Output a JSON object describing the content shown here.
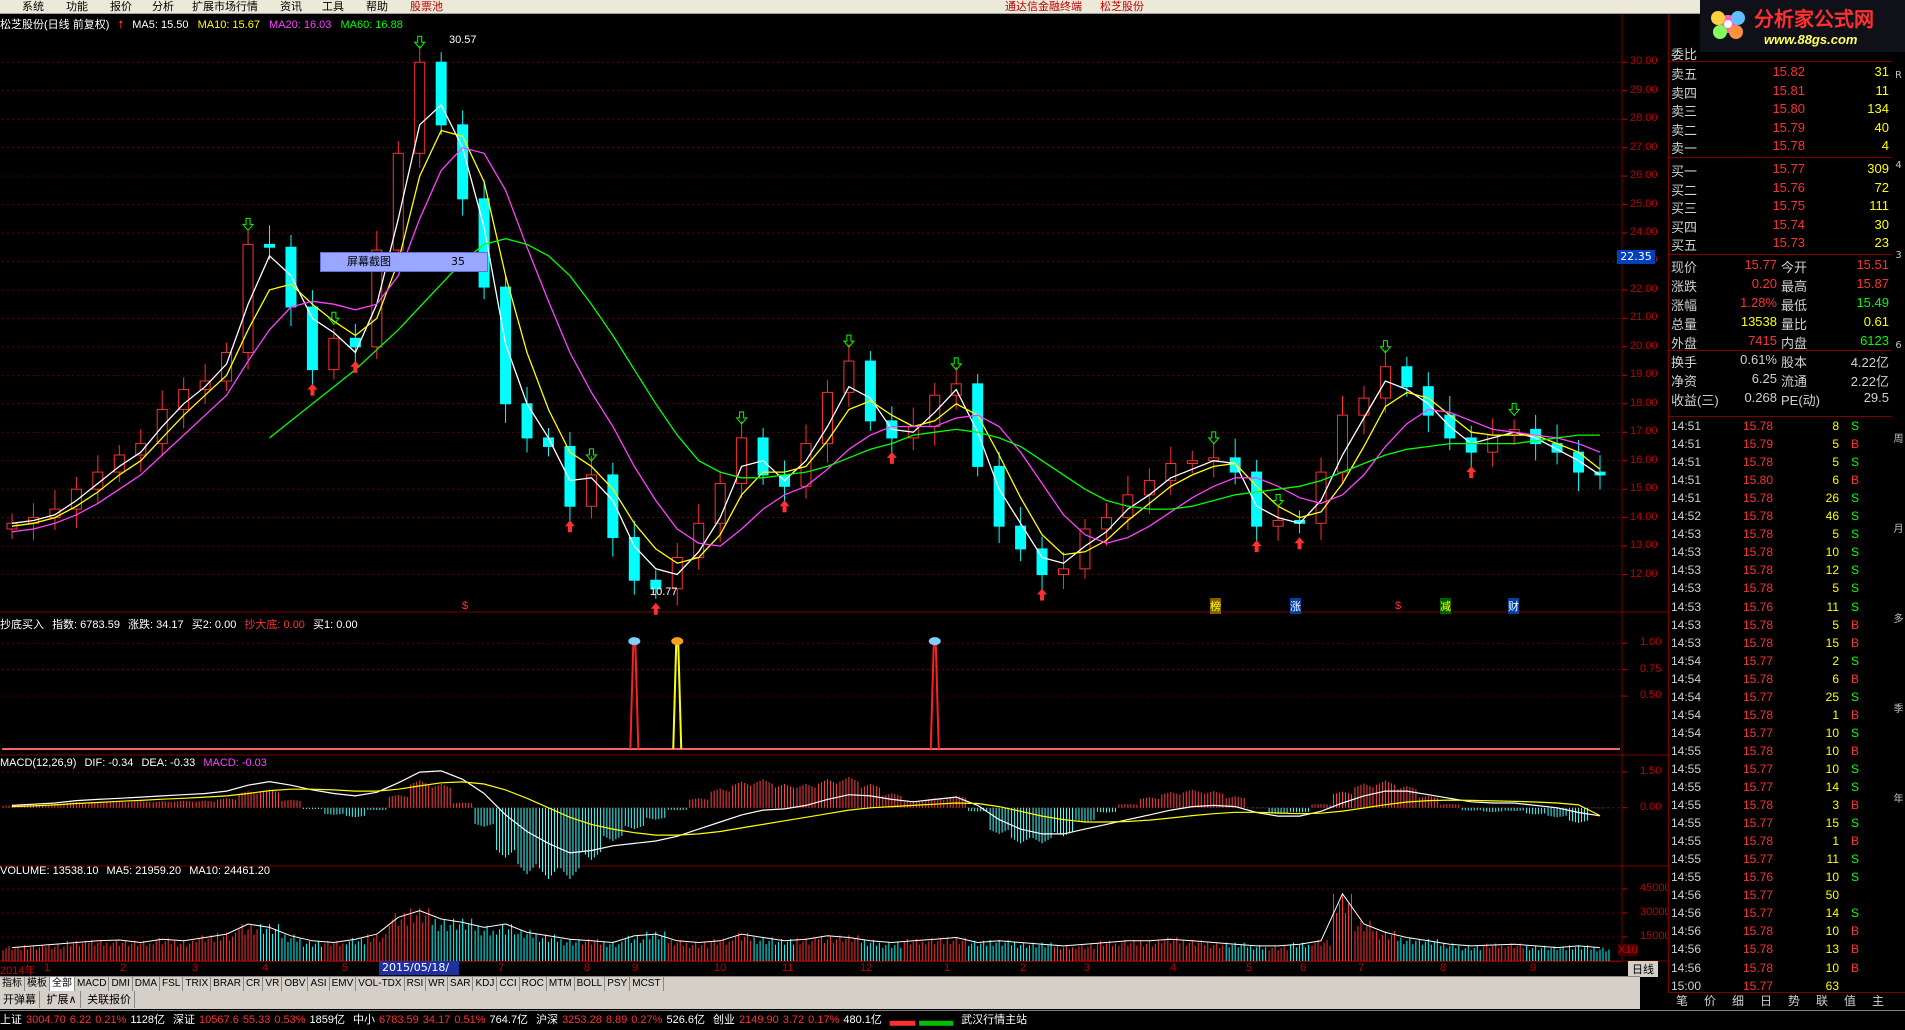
{
  "menubar": {
    "items": [
      "系统",
      "功能",
      "报价",
      "分析",
      "扩展市场行情",
      "资讯",
      "工具",
      "帮助"
    ],
    "special": "股票池",
    "center_title": "通达信金融终端",
    "center_stock": "松芝股份"
  },
  "chart_title": {
    "name": "松芝股份(日线 前复权)",
    "ma5": "MA5: 15.50",
    "ma10": "MA10: 15.67",
    "ma20": "MA20: 16.03",
    "ma60": "MA60: 16.88"
  },
  "colors": {
    "up": "#ff3030",
    "down": "#00ffff",
    "ma5": "#ffffff",
    "ma10": "#ffff00",
    "ma20": "#ff40ff",
    "ma60": "#00ff00",
    "grid": "#800000",
    "axis": "#c00000"
  },
  "price_axis": {
    "ticks": [
      "30.00",
      "29.00",
      "28.00",
      "27.00",
      "26.00",
      "25.00",
      "24.00",
      "23.00",
      "22.00",
      "21.00",
      "20.00",
      "19.00",
      "18.00",
      "17.00",
      "16.00",
      "15.00",
      "14.00",
      "13.00",
      "12.00"
    ]
  },
  "current_price_tag": "22.35",
  "screenshot_tip": {
    "label": "屏幕截图",
    "value": "35"
  },
  "high_annot": "30.57",
  "low_annot": "10.77",
  "event_markers": [
    "$",
    "榜",
    "涨",
    "$",
    "减",
    "财"
  ],
  "chart_data": [
    {
      "type": "candlestick",
      "title": "松芝股份(日线 前复权)",
      "ylim": [
        11.0,
        30.5
      ],
      "series": [
        {
          "name": "MA5",
          "values": [
            13.8,
            13.9,
            14.1,
            14.6,
            15.2,
            15.8,
            16.3,
            17.2,
            18.0,
            18.6,
            19.4,
            21.5,
            23.2,
            22.5,
            21.0,
            20.5,
            19.8,
            21.5,
            24.5,
            27.8,
            28.5,
            27.0,
            24.2,
            20.1,
            18.0,
            16.8,
            15.3,
            15.4,
            14.6,
            13.0,
            12.2,
            12.0,
            12.8,
            14.0,
            15.8,
            16.0,
            15.3,
            16.0,
            17.2,
            18.6,
            18.2,
            17.1,
            17.0,
            17.7,
            18.5,
            17.0,
            15.0,
            13.8,
            12.6,
            12.4,
            13.0,
            13.5,
            14.3,
            14.8,
            15.4,
            15.7,
            16.0,
            15.9,
            14.4,
            14.0,
            13.8,
            14.6,
            16.2,
            17.5,
            18.8,
            18.5,
            18.0,
            17.2,
            16.6,
            16.8,
            17.0,
            16.8,
            16.4,
            16.0,
            15.5
          ]
        },
        {
          "name": "MA10",
          "values": [
            13.7,
            13.8,
            14.0,
            14.4,
            14.9,
            15.5,
            16.0,
            16.8,
            17.6,
            18.3,
            19.0,
            20.6,
            22.0,
            22.2,
            21.5,
            20.9,
            20.4,
            21.0,
            23.0,
            26.0,
            27.6,
            27.4,
            25.8,
            22.5,
            19.8,
            17.8,
            16.3,
            15.8,
            15.0,
            13.8,
            12.9,
            12.4,
            12.6,
            13.4,
            14.8,
            15.6,
            15.6,
            15.8,
            16.7,
            17.8,
            18.1,
            17.6,
            17.2,
            17.4,
            18.0,
            17.6,
            16.2,
            14.7,
            13.4,
            12.7,
            12.8,
            13.2,
            13.9,
            14.5,
            15.1,
            15.5,
            15.8,
            15.9,
            15.1,
            14.4,
            14.0,
            14.2,
            15.2,
            16.5,
            17.9,
            18.4,
            18.2,
            17.6,
            17.0,
            16.9,
            16.9,
            16.9,
            16.6,
            16.3,
            15.7
          ]
        },
        {
          "name": "MA20",
          "values": [
            13.5,
            13.6,
            13.8,
            14.1,
            14.5,
            15.0,
            15.5,
            16.2,
            16.9,
            17.6,
            18.3,
            19.5,
            20.6,
            21.4,
            21.6,
            21.5,
            21.3,
            21.5,
            22.5,
            24.5,
            26.2,
            27.0,
            26.8,
            25.5,
            23.5,
            21.6,
            19.8,
            18.4,
            17.2,
            15.8,
            14.6,
            13.6,
            13.1,
            13.0,
            13.6,
            14.3,
            14.8,
            15.1,
            15.7,
            16.4,
            16.9,
            17.2,
            17.2,
            17.2,
            17.5,
            17.6,
            17.2,
            16.3,
            15.2,
            14.1,
            13.4,
            13.1,
            13.3,
            13.7,
            14.2,
            14.7,
            15.1,
            15.4,
            15.4,
            15.1,
            14.7,
            14.5,
            14.8,
            15.5,
            16.5,
            17.3,
            17.8,
            17.7,
            17.4,
            17.1,
            17.0,
            16.9,
            16.8,
            16.6,
            16.3
          ]
        },
        {
          "name": "MA60",
          "values": [
            null,
            null,
            null,
            null,
            null,
            null,
            null,
            null,
            null,
            null,
            null,
            null,
            16.8,
            17.4,
            18.0,
            18.6,
            19.2,
            19.9,
            20.6,
            21.4,
            22.2,
            23.0,
            23.6,
            23.8,
            23.6,
            23.2,
            22.5,
            21.5,
            20.4,
            19.2,
            18.0,
            16.9,
            16.0,
            15.6,
            15.4,
            15.4,
            15.5,
            15.6,
            15.8,
            16.1,
            16.4,
            16.6,
            16.9,
            17.0,
            17.1,
            17.0,
            16.8,
            16.5,
            16.0,
            15.5,
            15.0,
            14.6,
            14.4,
            14.3,
            14.3,
            14.4,
            14.6,
            14.8,
            14.9,
            15.0,
            15.1,
            15.3,
            15.6,
            15.9,
            16.2,
            16.4,
            16.5,
            16.6,
            16.6,
            16.6,
            16.6,
            16.7,
            16.8,
            16.9,
            16.9
          ]
        }
      ],
      "values": [
        13.8,
        14.0,
        14.3,
        15.0,
        15.6,
        16.2,
        16.6,
        17.8,
        18.5,
        18.8,
        19.8,
        23.6,
        23.5,
        21.4,
        19.2,
        20.3,
        20.0,
        23.4,
        26.8,
        30.0,
        27.8,
        25.2,
        22.1,
        18.0,
        16.8,
        16.5,
        14.4,
        15.5,
        13.3,
        11.8,
        11.5,
        12.6,
        13.8,
        15.2,
        16.8,
        15.5,
        15.1,
        16.6,
        18.4,
        19.5,
        17.4,
        16.8,
        17.2,
        18.3,
        18.7,
        15.8,
        13.7,
        12.9,
        12.0,
        12.2,
        13.6,
        14.0,
        14.8,
        15.3,
        15.9,
        16.0,
        16.1,
        15.6,
        13.7,
        13.9,
        13.8,
        15.6,
        17.6,
        18.2,
        19.3,
        18.6,
        17.6,
        16.8,
        16.3,
        16.9,
        17.1,
        16.6,
        16.3,
        15.6,
        15.5
      ]
    },
    {
      "type": "bar",
      "title": "抄底买入",
      "params": [
        "指数: 6783.59",
        "涨跌: 34.17",
        "买2: 0.00",
        "抄大底: 0.00",
        "买1: 0.00"
      ],
      "ylim": [
        0,
        1.2
      ],
      "yticks": [
        "1.00",
        "0.75",
        "0.50"
      ],
      "signals": [
        {
          "x": 29,
          "value": 1.0,
          "color": "#ff2020"
        },
        {
          "x": 31,
          "value": 1.0,
          "color": "#ffff00"
        },
        {
          "x": 43,
          "value": 1.0,
          "color": "#ff2020"
        }
      ]
    },
    {
      "type": "bar",
      "title": "MACD(12,26,9)",
      "params": [
        "DIF: -0.34",
        "DEA: -0.33",
        "MACD: -0.03"
      ],
      "ylim": [
        -2.2,
        1.8
      ],
      "yticks": [
        "1.50",
        "0.00"
      ],
      "series": [
        {
          "name": "DIF",
          "values": [
            0.1,
            0.15,
            0.2,
            0.3,
            0.35,
            0.4,
            0.45,
            0.5,
            0.55,
            0.6,
            0.7,
            0.95,
            1.1,
            0.95,
            0.75,
            0.6,
            0.5,
            0.65,
            1.05,
            1.5,
            1.55,
            1.2,
            0.6,
            -0.3,
            -1.0,
            -1.5,
            -1.9,
            -1.8,
            -1.6,
            -1.5,
            -1.4,
            -1.2,
            -0.9,
            -0.6,
            -0.3,
            -0.1,
            -0.05,
            0.1,
            0.35,
            0.55,
            0.5,
            0.35,
            0.25,
            0.35,
            0.45,
            0.1,
            -0.5,
            -0.9,
            -1.1,
            -1.1,
            -0.9,
            -0.7,
            -0.5,
            -0.3,
            -0.1,
            0.05,
            0.1,
            0.05,
            -0.2,
            -0.35,
            -0.35,
            -0.15,
            0.2,
            0.5,
            0.7,
            0.7,
            0.55,
            0.4,
            0.25,
            0.2,
            0.2,
            0.1,
            0.0,
            -0.2,
            -0.34
          ]
        },
        {
          "name": "DEA",
          "values": [
            0.05,
            0.08,
            0.12,
            0.18,
            0.22,
            0.27,
            0.31,
            0.36,
            0.4,
            0.45,
            0.5,
            0.6,
            0.72,
            0.78,
            0.78,
            0.75,
            0.7,
            0.7,
            0.78,
            0.92,
            1.05,
            1.09,
            1.0,
            0.75,
            0.4,
            0.0,
            -0.4,
            -0.7,
            -0.9,
            -1.05,
            -1.15,
            -1.15,
            -1.1,
            -1.0,
            -0.85,
            -0.7,
            -0.55,
            -0.4,
            -0.25,
            -0.1,
            0.0,
            0.05,
            0.1,
            0.15,
            0.2,
            0.18,
            0.05,
            -0.15,
            -0.35,
            -0.5,
            -0.6,
            -0.6,
            -0.58,
            -0.52,
            -0.43,
            -0.33,
            -0.25,
            -0.19,
            -0.19,
            -0.22,
            -0.25,
            -0.23,
            -0.14,
            -0.01,
            0.13,
            0.24,
            0.3,
            0.32,
            0.31,
            0.29,
            0.27,
            0.24,
            0.2,
            0.12,
            -0.33
          ]
        }
      ]
    },
    {
      "type": "bar",
      "title": "VOLUME",
      "params": [
        "VOLUME: 13538.10",
        "MA5: 21959.20",
        "MA10: 24461.20"
      ],
      "ylim": [
        0,
        50000
      ],
      "yticks": [
        "45000",
        "30000",
        "15000"
      ],
      "unit": "X10",
      "values": [
        8000,
        9000,
        10000,
        11000,
        12000,
        12500,
        11000,
        13000,
        12000,
        14000,
        16000,
        22000,
        20000,
        15000,
        12000,
        11000,
        13000,
        16000,
        26000,
        30000,
        25000,
        23000,
        20000,
        22000,
        17000,
        15000,
        13000,
        12000,
        11000,
        15000,
        16000,
        12000,
        11000,
        12000,
        16000,
        14000,
        12000,
        13000,
        15000,
        14000,
        12000,
        11000,
        12000,
        13000,
        14000,
        11000,
        12000,
        11000,
        10000,
        9000,
        10000,
        11000,
        12000,
        12000,
        13000,
        12000,
        11000,
        10000,
        9000,
        9000,
        10000,
        12000,
        40000,
        22000,
        17000,
        14000,
        12000,
        10000,
        9000,
        9500,
        10000,
        9000,
        8000,
        9000,
        8000
      ]
    }
  ],
  "xaxis": {
    "labels": [
      "2014年",
      "1",
      "2",
      "3",
      "4",
      "5",
      "6",
      "7",
      "8",
      "9",
      "10",
      "11",
      "12",
      "1",
      "2",
      "3",
      "4",
      "5",
      "6",
      "7",
      "8",
      "9"
    ],
    "highlight": "2015/05/18/一",
    "period": "日线"
  },
  "indicator_tabs": [
    "指标",
    "模板",
    "全部",
    "MACD",
    "DMI",
    "DMA",
    "FSL",
    "TRIX",
    "BRAR",
    "CR",
    "VR",
    "OBV",
    "ASI",
    "EMV",
    "VOL-TDX",
    "RSI",
    "WR",
    "SAR",
    "KDJ",
    "CCI",
    "ROC",
    "MTM",
    "BOLL",
    "PSY",
    "MCST"
  ],
  "bottom_tabs": [
    "开弹幕",
    "扩展∧",
    "关联报价"
  ],
  "status_bar": {
    "items": [
      {
        "name": "上证",
        "value": "3004.70",
        "chg": "6.22",
        "pct": "0.21%",
        "amt": "1128亿"
      },
      {
        "name": "深证",
        "value": "10567.6",
        "chg": "55.33",
        "pct": "0.53%",
        "amt": "1859亿"
      },
      {
        "name": "中小",
        "value": "6783.59",
        "chg": "34.17",
        "pct": "0.51%",
        "amt": "764.7亿"
      },
      {
        "name": "沪深",
        "value": "3253.28",
        "chg": "8.89",
        "pct": "0.27%",
        "amt": "526.6亿"
      },
      {
        "name": "创业",
        "value": "2149.90",
        "chg": "3.72",
        "pct": "0.17%",
        "amt": "480.1亿"
      }
    ],
    "host": "武汉行情主站"
  },
  "logo": {
    "title": "分析家公式网",
    "url": "www.88gs.com"
  },
  "quote_panel": {
    "weibi_label": "委比",
    "sell": [
      {
        "label": "卖五",
        "price": "15.82",
        "vol": "31"
      },
      {
        "label": "卖四",
        "price": "15.81",
        "vol": "11"
      },
      {
        "label": "卖三",
        "price": "15.80",
        "vol": "134"
      },
      {
        "label": "卖二",
        "price": "15.79",
        "vol": "40"
      },
      {
        "label": "卖一",
        "price": "15.78",
        "vol": "4"
      }
    ],
    "buy": [
      {
        "label": "买一",
        "price": "15.77",
        "vol": "309"
      },
      {
        "label": "买二",
        "price": "15.76",
        "vol": "72"
      },
      {
        "label": "买三",
        "price": "15.75",
        "vol": "111"
      },
      {
        "label": "买四",
        "price": "15.74",
        "vol": "30"
      },
      {
        "label": "买五",
        "price": "15.73",
        "vol": "23"
      }
    ],
    "details": [
      {
        "l1": "现价",
        "v1": "15.77",
        "l2": "今开",
        "v2": "15.51"
      },
      {
        "l1": "涨跌",
        "v1": "0.20",
        "l2": "最高",
        "v2": "15.87"
      },
      {
        "l1": "涨幅",
        "v1": "1.28%",
        "l2": "最低",
        "v2": "15.49"
      },
      {
        "l1": "总量",
        "v1": "13538",
        "l2": "量比",
        "v2": "0.61"
      },
      {
        "l1": "外盘",
        "v1": "7415",
        "l2": "内盘",
        "v2": "6123"
      },
      {
        "l1": "换手",
        "v1": "0.61%",
        "l2": "股本",
        "v2": "4.22亿"
      },
      {
        "l1": "净资",
        "v1": "6.25",
        "l2": "流通",
        "v2": "2.22亿"
      },
      {
        "l1": "收益(三)",
        "v1": "0.268",
        "l2": "PE(动)",
        "v2": "29.5"
      }
    ],
    "ticks": [
      {
        "t": "14:51",
        "p": "15.78",
        "v": "8",
        "d": "S"
      },
      {
        "t": "14:51",
        "p": "15.79",
        "v": "5",
        "d": "B"
      },
      {
        "t": "14:51",
        "p": "15.78",
        "v": "5",
        "d": "S"
      },
      {
        "t": "14:51",
        "p": "15.80",
        "v": "6",
        "d": "B"
      },
      {
        "t": "14:51",
        "p": "15.78",
        "v": "26",
        "d": "S"
      },
      {
        "t": "14:52",
        "p": "15.78",
        "v": "46",
        "d": "S"
      },
      {
        "t": "14:53",
        "p": "15.78",
        "v": "5",
        "d": "S"
      },
      {
        "t": "14:53",
        "p": "15.78",
        "v": "10",
        "d": "S"
      },
      {
        "t": "14:53",
        "p": "15.78",
        "v": "12",
        "d": "S"
      },
      {
        "t": "14:53",
        "p": "15.78",
        "v": "5",
        "d": "S"
      },
      {
        "t": "14:53",
        "p": "15.76",
        "v": "11",
        "d": "S"
      },
      {
        "t": "14:53",
        "p": "15.78",
        "v": "5",
        "d": "B"
      },
      {
        "t": "14:53",
        "p": "15.78",
        "v": "15",
        "d": "B"
      },
      {
        "t": "14:54",
        "p": "15.77",
        "v": "2",
        "d": "S"
      },
      {
        "t": "14:54",
        "p": "15.78",
        "v": "6",
        "d": "B"
      },
      {
        "t": "14:54",
        "p": "15.77",
        "v": "25",
        "d": "S"
      },
      {
        "t": "14:54",
        "p": "15.78",
        "v": "1",
        "d": "B"
      },
      {
        "t": "14:54",
        "p": "15.77",
        "v": "10",
        "d": "S"
      },
      {
        "t": "14:55",
        "p": "15.78",
        "v": "10",
        "d": "B"
      },
      {
        "t": "14:55",
        "p": "15.77",
        "v": "10",
        "d": "S"
      },
      {
        "t": "14:55",
        "p": "15.77",
        "v": "14",
        "d": "S"
      },
      {
        "t": "14:55",
        "p": "15.78",
        "v": "3",
        "d": "B"
      },
      {
        "t": "14:55",
        "p": "15.77",
        "v": "15",
        "d": "S"
      },
      {
        "t": "14:55",
        "p": "15.78",
        "v": "1",
        "d": "B"
      },
      {
        "t": "14:55",
        "p": "15.77",
        "v": "11",
        "d": "S"
      },
      {
        "t": "14:55",
        "p": "15.76",
        "v": "10",
        "d": "S"
      },
      {
        "t": "14:56",
        "p": "15.77",
        "v": "50",
        "d": ""
      },
      {
        "t": "14:56",
        "p": "15.77",
        "v": "14",
        "d": "S"
      },
      {
        "t": "14:56",
        "p": "15.78",
        "v": "10",
        "d": "B"
      },
      {
        "t": "14:56",
        "p": "15.78",
        "v": "13",
        "d": "B"
      },
      {
        "t": "14:56",
        "p": "15.78",
        "v": "10",
        "d": "B"
      },
      {
        "t": "15:00",
        "p": "15.77",
        "v": "63",
        "d": ""
      }
    ],
    "bottom_tabs": [
      "笔",
      "价",
      "细",
      "日",
      "势",
      "联",
      "值",
      "主"
    ]
  },
  "right_strip": [
    "R",
    "4",
    "3",
    "6",
    "周",
    "月",
    "多",
    "季",
    "年"
  ]
}
